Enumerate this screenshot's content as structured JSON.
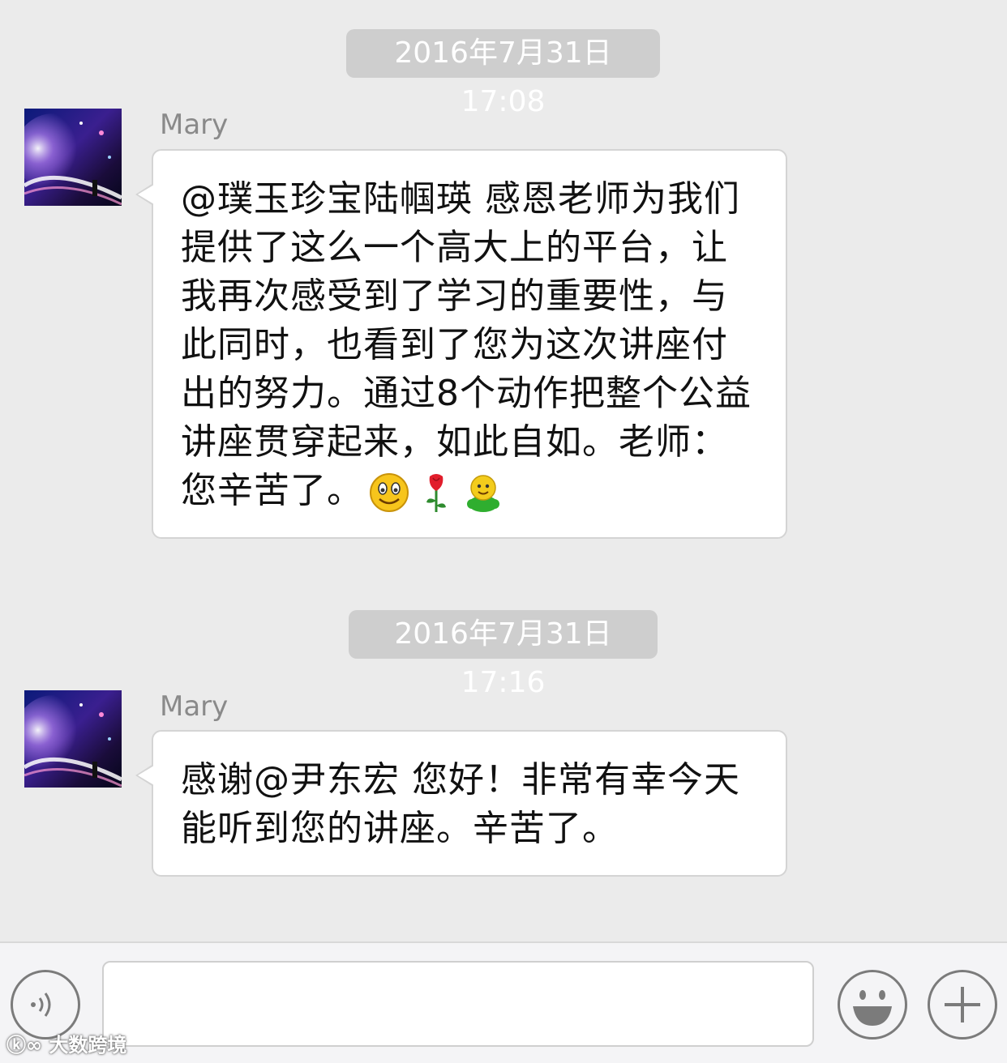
{
  "messages": [
    {
      "timestamp": "2016年7月31日 17:08",
      "sender": "Mary",
      "text": "@璞玉珍宝陆帼瑛 感恩老师为我们提供了这么一个高大上的平台，让我再次感受到了学习的重要性，与此同时，也看到了您为这次讲座付出的努力。通过8个动作把整个公益讲座贯穿起来，如此自如。老师：您辛苦了。",
      "emojis": [
        "smile-emoji",
        "rose-emoji",
        "green-figure-emoji"
      ]
    },
    {
      "timestamp": "2016年7月31日 17:16",
      "sender": "Mary",
      "text": "感谢@尹东宏 您好！非常有幸今天能听到您的讲座。辛苦了。"
    }
  ],
  "input_bar": {
    "voice_button_icon": "voice-icon",
    "emoji_button_icon": "smiley-icon",
    "more_button_icon": "plus-icon",
    "text_value": ""
  },
  "watermark": {
    "text": "大数跨境"
  },
  "colors": {
    "background": "#ebebeb",
    "timestamp_pill": "#cecece",
    "bubble": "#ffffff",
    "bubble_border": "#d4d4d4",
    "sender_name": "#8a8a8a"
  }
}
